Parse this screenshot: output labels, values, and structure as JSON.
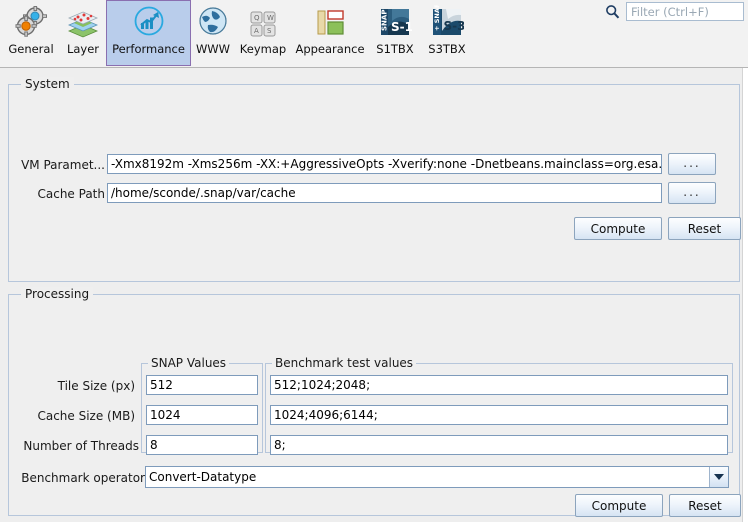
{
  "toolbar": {
    "tabs": [
      {
        "id": "general",
        "label": "General",
        "icon": "gears-icon",
        "selected": false
      },
      {
        "id": "layer",
        "label": "Layer",
        "icon": "layers-icon",
        "selected": false
      },
      {
        "id": "performance",
        "label": "Performance",
        "icon": "performance-chart-icon",
        "selected": true
      },
      {
        "id": "www",
        "label": "WWW",
        "icon": "globe-icon",
        "selected": false
      },
      {
        "id": "keymap",
        "label": "Keymap",
        "icon": "keyboard-keys-icon",
        "selected": false
      },
      {
        "id": "appearance",
        "label": "Appearance",
        "icon": "appearance-panels-icon",
        "selected": false
      },
      {
        "id": "s1tbx",
        "label": "S1TBX",
        "icon": "snap-s1-icon",
        "selected": false
      },
      {
        "id": "s3tbx",
        "label": "S3TBX",
        "icon": "snap-s3-icon",
        "selected": false
      }
    ],
    "filter": {
      "icon": "search-icon",
      "value": "",
      "placeholder": "Filter (Ctrl+F)"
    }
  },
  "system": {
    "title": "System",
    "vm_parameters": {
      "label": "VM Paramet...",
      "value": "-Xmx8192m  -Xms256m -XX:+AggressiveOpts -Xverify:none -Dnetbeans.mainclass=org.esa.snap",
      "browse_label": "..."
    },
    "cache_path": {
      "label": "Cache Path",
      "value": "/home/sconde/.snap/var/cache",
      "browse_label": "..."
    },
    "compute_label": "Compute",
    "reset_label": "Reset"
  },
  "processing": {
    "title": "Processing",
    "columns": {
      "snap_values": "SNAP Values",
      "benchmark_values": "Benchmark test values"
    },
    "rows": [
      {
        "label": "Tile Size (px)",
        "snap_value": "512",
        "benchmark_value": "512;1024;2048;"
      },
      {
        "label": "Cache Size (MB)",
        "snap_value": "1024",
        "benchmark_value": "1024;4096;6144;"
      },
      {
        "label": "Number of Threads",
        "snap_value": "8",
        "benchmark_value": "8;"
      }
    ],
    "benchmark_operator": {
      "label": "Benchmark operator",
      "value": "Convert-Datatype"
    },
    "compute_label": "Compute",
    "reset_label": "Reset"
  },
  "colors": {
    "selected_tab_bg": "#b9cdeb",
    "selected_tab_border": "#8a6fb0",
    "panel_bg": "#efefef",
    "panel_border": "#b6c6db",
    "field_border": "#7e9bbb"
  }
}
